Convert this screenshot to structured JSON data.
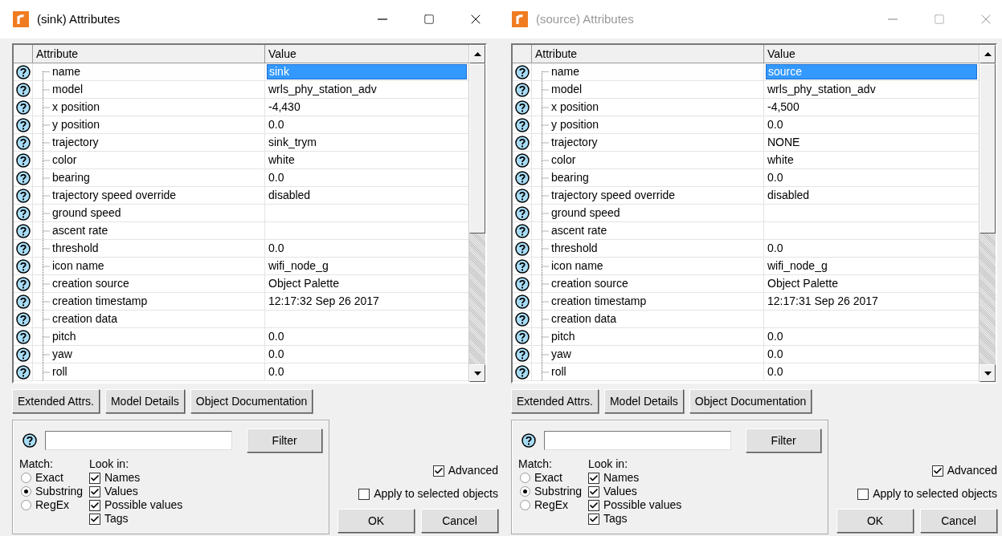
{
  "windows": [
    {
      "title": "(sink) Attributes",
      "active": true,
      "table": {
        "columns": [
          "Attribute",
          "Value"
        ],
        "rows": [
          {
            "attribute": "name",
            "value": "sink",
            "selected": true
          },
          {
            "attribute": "model",
            "value": "wrls_phy_station_adv",
            "selected": false
          },
          {
            "attribute": "x position",
            "value": "-4,430",
            "selected": false
          },
          {
            "attribute": "y position",
            "value": "0.0",
            "selected": false
          },
          {
            "attribute": "trajectory",
            "value": "sink_trym",
            "selected": false
          },
          {
            "attribute": "color",
            "value": "white",
            "selected": false
          },
          {
            "attribute": "bearing",
            "value": "0.0",
            "selected": false
          },
          {
            "attribute": "trajectory speed override",
            "value": "disabled",
            "selected": false
          },
          {
            "attribute": "ground speed",
            "selected": false
          },
          {
            "attribute": "ascent rate",
            "selected": false
          },
          {
            "attribute": "threshold",
            "value": "0.0",
            "selected": false
          },
          {
            "attribute": "icon name",
            "value": "wifi_node_g",
            "selected": false
          },
          {
            "attribute": "creation source",
            "value": "Object Palette",
            "selected": false
          },
          {
            "attribute": "creation timestamp",
            "value": "12:17:32 Sep 26 2017",
            "selected": false
          },
          {
            "attribute": "creation data",
            "selected": false
          },
          {
            "attribute": "pitch",
            "value": "0.0",
            "selected": false
          },
          {
            "attribute": "yaw",
            "value": "0.0",
            "selected": false
          },
          {
            "attribute": "roll",
            "value": "0.0",
            "selected": false
          }
        ]
      },
      "buttons": [
        "Extended Attrs.",
        "Model Details",
        "Object Documentation"
      ],
      "filter": {
        "button": "Filter",
        "match_label": "Match:",
        "match_options": [
          {
            "label": "Exact",
            "selected": false
          },
          {
            "label": "Substring",
            "selected": true
          },
          {
            "label": "RegEx",
            "selected": false
          }
        ],
        "look_in_label": "Look in:",
        "look_in": [
          {
            "label": "Names",
            "checked": true
          },
          {
            "label": "Values",
            "checked": true
          },
          {
            "label": "Possible values",
            "checked": true
          },
          {
            "label": "Tags",
            "checked": true
          }
        ]
      },
      "advanced": {
        "label": "Advanced",
        "checked": true
      },
      "apply": {
        "label": "Apply to selected objects",
        "checked": false
      },
      "ok": "OK",
      "cancel": "Cancel"
    },
    {
      "title": "(source) Attributes",
      "active": false,
      "table": {
        "columns": [
          "Attribute",
          "Value"
        ],
        "rows": [
          {
            "attribute": "name",
            "value": "source",
            "selected": true
          },
          {
            "attribute": "model",
            "value": "wrls_phy_station_adv",
            "selected": false
          },
          {
            "attribute": "x position",
            "value": "-4,500",
            "selected": false
          },
          {
            "attribute": "y position",
            "value": "0.0",
            "selected": false
          },
          {
            "attribute": "trajectory",
            "value": "NONE",
            "selected": false
          },
          {
            "attribute": "color",
            "value": "white",
            "selected": false
          },
          {
            "attribute": "bearing",
            "value": "0.0",
            "selected": false
          },
          {
            "attribute": "trajectory speed override",
            "value": "disabled",
            "selected": false
          },
          {
            "attribute": "ground speed",
            "selected": false
          },
          {
            "attribute": "ascent rate",
            "selected": false
          },
          {
            "attribute": "threshold",
            "value": "0.0",
            "selected": false
          },
          {
            "attribute": "icon name",
            "value": "wifi_node_g",
            "selected": false
          },
          {
            "attribute": "creation source",
            "value": "Object Palette",
            "selected": false
          },
          {
            "attribute": "creation timestamp",
            "value": "12:17:31 Sep 26 2017",
            "selected": false
          },
          {
            "attribute": "creation data",
            "selected": false
          },
          {
            "attribute": "pitch",
            "value": "0.0",
            "selected": false
          },
          {
            "attribute": "yaw",
            "value": "0.0",
            "selected": false
          },
          {
            "attribute": "roll",
            "value": "0.0",
            "selected": false
          }
        ]
      },
      "buttons": [
        "Extended Attrs.",
        "Model Details",
        "Object Documentation"
      ],
      "filter": {
        "button": "Filter",
        "match_label": "Match:",
        "match_options": [
          {
            "label": "Exact",
            "selected": false
          },
          {
            "label": "Substring",
            "selected": true
          },
          {
            "label": "RegEx",
            "selected": false
          }
        ],
        "look_in_label": "Look in:",
        "look_in": [
          {
            "label": "Names",
            "checked": true
          },
          {
            "label": "Values",
            "checked": true
          },
          {
            "label": "Possible values",
            "checked": true
          },
          {
            "label": "Tags",
            "checked": true
          }
        ]
      },
      "advanced": {
        "label": "Advanced",
        "checked": true
      },
      "apply": {
        "label": "Apply to selected objects",
        "checked": false
      },
      "ok": "OK",
      "cancel": "Cancel"
    }
  ]
}
